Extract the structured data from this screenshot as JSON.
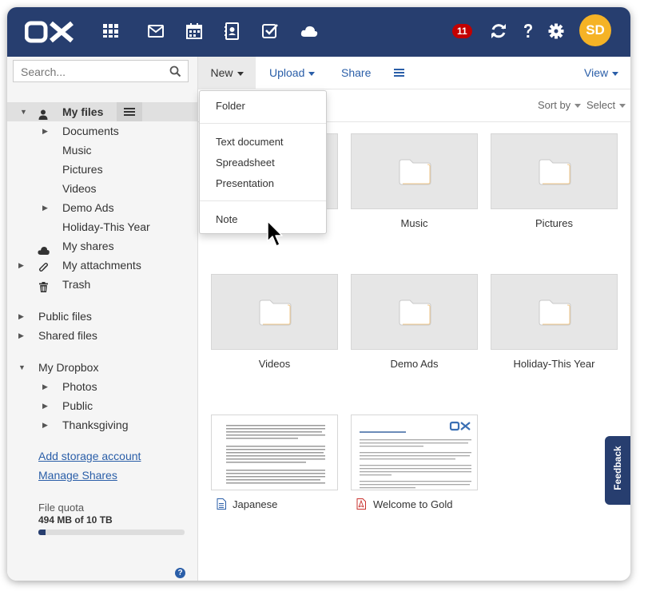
{
  "header": {
    "logo_text": "OX",
    "notification_count": "11",
    "avatar_initials": "SD",
    "icons": [
      "apps-grid-icon",
      "mail-icon",
      "calendar-icon",
      "address-book-icon",
      "tasks-icon",
      "drive-cloud-icon",
      "refresh-icon",
      "help-icon",
      "settings-icon"
    ]
  },
  "sidebar": {
    "search_placeholder": "Search...",
    "my_files": "My files",
    "tree": {
      "documents": "Documents",
      "music": "Music",
      "pictures": "Pictures",
      "videos": "Videos",
      "demo_ads": "Demo Ads",
      "holiday": "Holiday-This Year",
      "my_shares": "My shares",
      "my_attachments": "My attachments",
      "trash": "Trash",
      "public_files": "Public files",
      "shared_files": "Shared files",
      "my_dropbox": "My Dropbox",
      "photos": "Photos",
      "public": "Public",
      "thanksgiving": "Thanksgiving"
    },
    "add_storage": "Add storage account",
    "manage_shares": "Manage Shares",
    "quota_label": "File quota",
    "quota_value": "494 MB of 10 TB",
    "quota_fraction": 0.048
  },
  "toolbar": {
    "new": "New",
    "upload": "Upload",
    "share": "Share",
    "view": "View"
  },
  "sortbar": {
    "sort_by": "Sort by",
    "select": "Select"
  },
  "new_menu": {
    "folder": "Folder",
    "text_document": "Text document",
    "spreadsheet": "Spreadsheet",
    "presentation": "Presentation",
    "note": "Note"
  },
  "items": {
    "music": "Music",
    "pictures": "Pictures",
    "videos": "Videos",
    "demo_ads": "Demo Ads",
    "holiday": "Holiday-This Year",
    "japanese": "Japanese",
    "welcome": "Welcome to Gold"
  },
  "feedback": "Feedback",
  "colors": {
    "header": "#273e6f",
    "accent_link": "#2a5ea8",
    "badge": "#c30000",
    "avatar": "#f5b326"
  }
}
